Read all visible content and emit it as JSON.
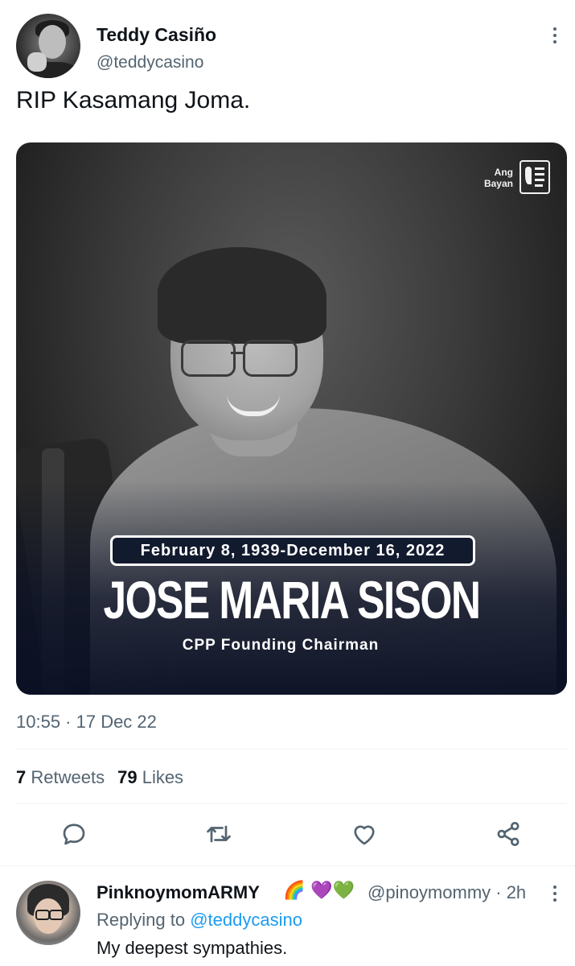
{
  "tweet": {
    "author_name": "Teddy Casiño",
    "author_handle": "@teddycasino",
    "text": "RIP Kasamang Joma.",
    "timestamp": "10:55 · 17 Dec 22",
    "retweets_count": "7",
    "retweets_label": "Retweets",
    "likes_count": "79",
    "likes_label": "Likes"
  },
  "media": {
    "logo_line1": "Ang",
    "logo_line2": "Bayan",
    "dates": "February 8, 1939-December 16, 2022",
    "name": "JOSE MARIA SISON",
    "subtitle": "CPP Founding Chairman"
  },
  "actions": [
    "reply-icon",
    "retweet-icon",
    "like-icon",
    "share-icon"
  ],
  "reply": {
    "author_name": "PinknoymomARMY",
    "badges": "🌈 💜💚",
    "author_handle": "@pinoymommy · 2h",
    "replying_prefix": "Replying to",
    "replying_to": "@teddycasino",
    "text": "My deepest sympathies."
  },
  "colors": {
    "accent": "#1d9bf0",
    "secondary_text": "#536471",
    "primary_text": "#0f1419"
  }
}
